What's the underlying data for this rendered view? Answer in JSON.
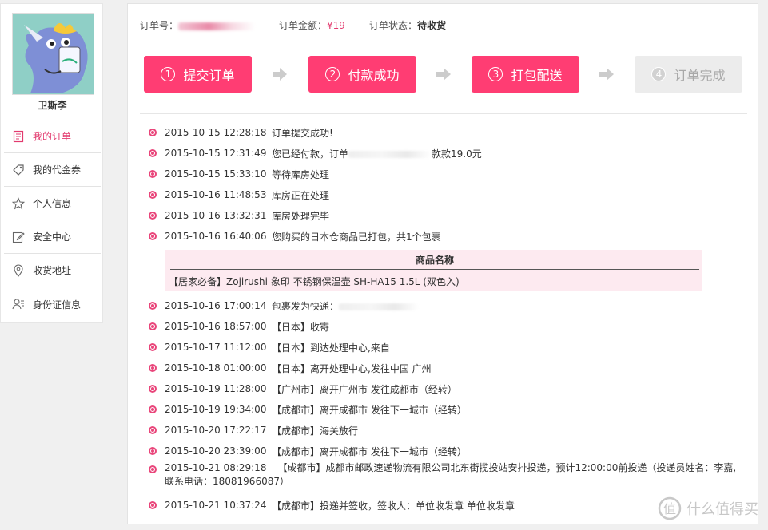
{
  "user": {
    "name": "卫斯李"
  },
  "sidebar": {
    "items": [
      {
        "label": "我的订单",
        "icon": "order-list-icon",
        "active": true
      },
      {
        "label": "我的代金券",
        "icon": "tag-icon",
        "active": false
      },
      {
        "label": "个人信息",
        "icon": "star-icon",
        "active": false
      },
      {
        "label": "安全中心",
        "icon": "edit-icon",
        "active": false
      },
      {
        "label": "收货地址",
        "icon": "location-pin-icon",
        "active": false
      },
      {
        "label": "身份证信息",
        "icon": "id-card-icon",
        "active": false
      }
    ]
  },
  "order": {
    "number_label": "订单号：",
    "number_value": "110...",
    "amount_label": "订单金额：",
    "amount_value": "¥19",
    "status_label": "订单状态：",
    "status_value": "待收货"
  },
  "steps": [
    {
      "num": "1",
      "label": "提交订单",
      "state": "active"
    },
    {
      "num": "2",
      "label": "付款成功",
      "state": "active"
    },
    {
      "num": "3",
      "label": "打包配送",
      "state": "active"
    },
    {
      "num": "4",
      "label": "订单完成",
      "state": "inactive"
    }
  ],
  "timeline_before": [
    {
      "time": "2015-10-15 12:28:18",
      "text": "订单提交成功!"
    },
    {
      "time": "2015-10-15 12:31:49",
      "text": "您已经付款，订单",
      "text_tail": "款款19.0元"
    },
    {
      "time": "2015-10-15 15:33:10",
      "text": "等待库房处理"
    },
    {
      "time": "2015-10-16 11:48:53",
      "text": "库房正在处理"
    },
    {
      "time": "2015-10-16 13:32:31",
      "text": "库房处理完毕"
    },
    {
      "time": "2015-10-16 16:40:06",
      "text": "您购买的日本仓商品已打包，共1个包裹"
    }
  ],
  "package": {
    "header": "商品名称",
    "item": "【居家必备】Zojirushi 象印 不锈钢保温壶 SH-HA15 1.5L (双色入)"
  },
  "timeline_after": [
    {
      "time": "2015-10-16 17:00:14",
      "text": "包裹发为快递："
    },
    {
      "time": "2015-10-16 18:57:00",
      "text": "【日本】收寄"
    },
    {
      "time": "2015-10-17 11:12:00",
      "text": "【日本】到达处理中心,来自"
    },
    {
      "time": "2015-10-18 01:00:00",
      "text": "【日本】离开处理中心,发往中国 广州"
    },
    {
      "time": "2015-10-19 11:28:00",
      "text": "【广州市】离开广州市 发往成都市（经转）"
    },
    {
      "time": "2015-10-19 19:34:00",
      "text": "【成都市】离开成都市 发往下一城市（经转）"
    },
    {
      "time": "2015-10-20 17:22:17",
      "text": "【成都市】海关放行"
    },
    {
      "time": "2015-10-20 23:39:00",
      "text": "【成都市】离开成都市 发往下一城市（经转）"
    },
    {
      "time": "2015-10-21 08:29:18",
      "text": "【成都市】成都市邮政速递物流有限公司北东街揽投站安排投递，预计12:00:00前投递（投递员姓名：李嘉,联系电话：18081966087）",
      "tall": true
    },
    {
      "time": "2015-10-21 10:37:24",
      "text": "【成都市】投递并签收，签收人：单位收发章 单位收发章"
    }
  ],
  "watermark": {
    "text": "什么值得买",
    "icon": "smzdm-logo-icon"
  },
  "colors": {
    "accent": "#ff3d73",
    "accent_text": "#e23a6e",
    "inactive_step": "#ececec"
  }
}
